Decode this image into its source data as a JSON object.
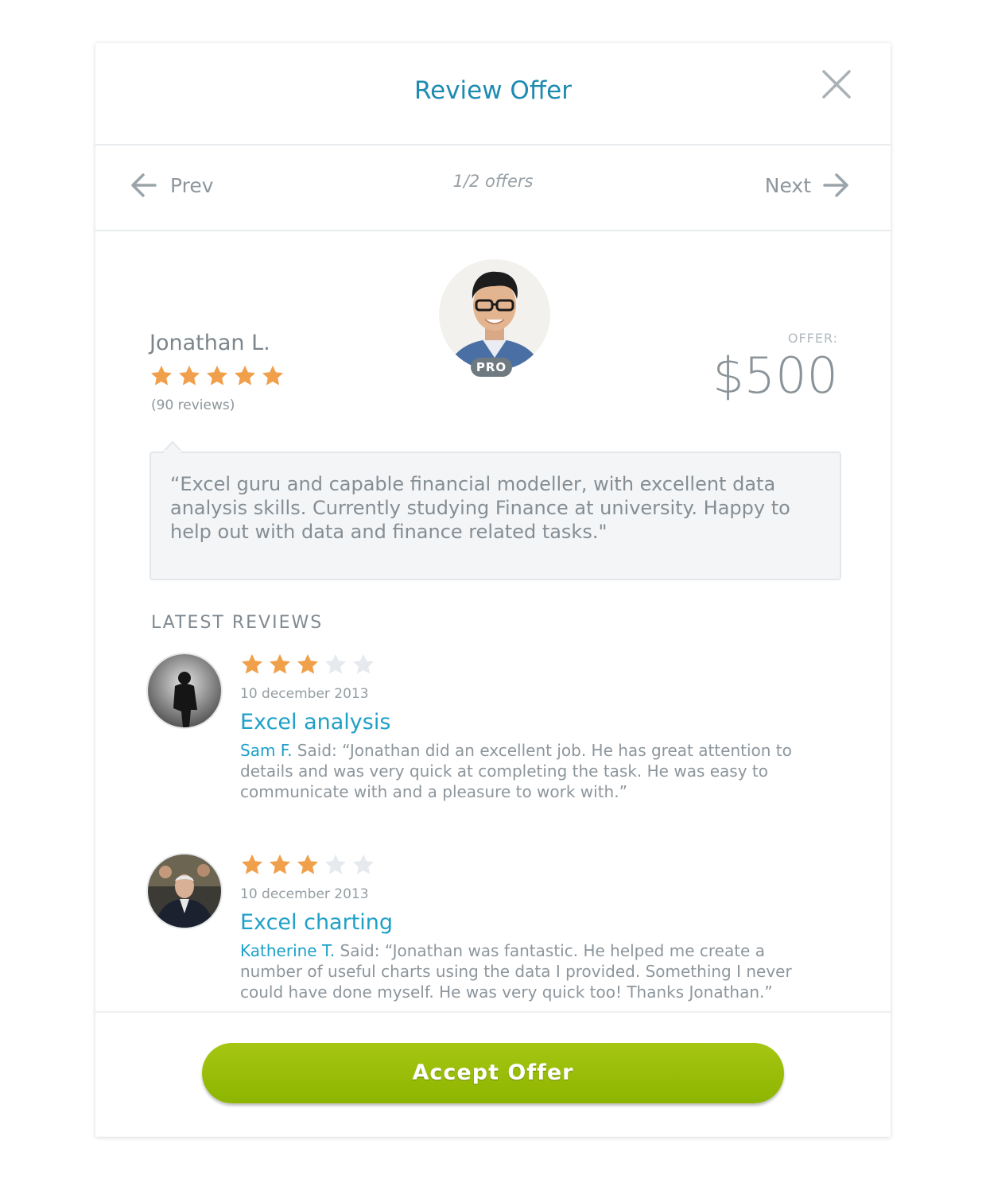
{
  "header": {
    "title": "Review Offer"
  },
  "nav": {
    "prev_label": "Prev",
    "next_label": "Next",
    "count": "1/2 offers"
  },
  "profile": {
    "name": "Jonathan L.",
    "rating": 5,
    "reviews_count": "(90 reviews)",
    "badge": "PRO",
    "offer_label": "OFFER:",
    "offer_value": "$500",
    "bio": "“Excel guru and capable financial modeller, with excellent data analysis skills. Currently studying Finance at university. Happy to help out with data and finance related tasks.\""
  },
  "latest_reviews": {
    "heading": "LATEST REVIEWS",
    "items": [
      {
        "rating": 3,
        "max_rating": 5,
        "date": "10 december 2013",
        "title": "Excel analysis",
        "author": "Sam F.",
        "said": " Said: “Jonathan did an excellent job. He has great attention to details and was very quick at completing the task. He was easy to communicate with and a pleasure to work with.”"
      },
      {
        "rating": 3,
        "max_rating": 5,
        "date": "10 december 2013",
        "title": "Excel charting",
        "author": "Katherine T.",
        "said": " Said: “Jonathan was fantastic. He helped me create a number of useful charts using the data I provided. Something I never could have done myself. He was very quick too! Thanks Jonathan.”"
      }
    ]
  },
  "footer": {
    "accept_label": "Accept Offer"
  },
  "colors": {
    "accent": "#1ea0c8",
    "title": "#1e8bb0",
    "star_on": "#f0a04b",
    "star_off": "#e6eaee",
    "accept": "#9bc10a"
  }
}
